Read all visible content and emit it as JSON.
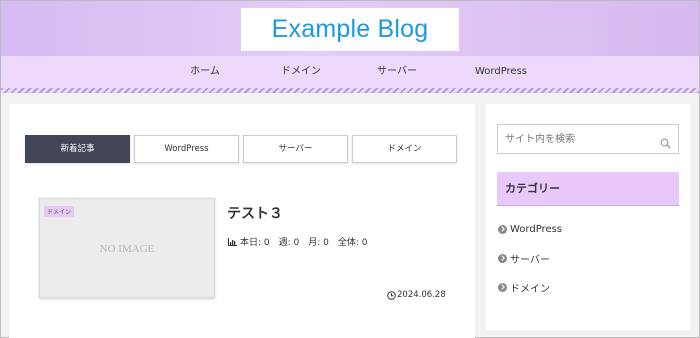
{
  "header": {
    "site_title": "Example Blog"
  },
  "nav": {
    "items": [
      {
        "label": "ホーム"
      },
      {
        "label": "ドメイン"
      },
      {
        "label": "サーバー"
      },
      {
        "label": "WordPress"
      }
    ]
  },
  "tabs": [
    {
      "label": "新着記事",
      "active": true
    },
    {
      "label": "WordPress"
    },
    {
      "label": "サーバー"
    },
    {
      "label": "ドメイン"
    }
  ],
  "post": {
    "category_badge": "ドメイン",
    "thumbnail_text": "NO IMAGE",
    "title": "テスト３",
    "stats": "本日: 0　週: 0　月: 0　全体: 0",
    "date": "2024.06.28"
  },
  "sidebar": {
    "search_placeholder": "サイト内を検索",
    "category_heading": "カテゴリー",
    "categories": [
      {
        "label": "WordPress"
      },
      {
        "label": "サーバー"
      },
      {
        "label": "ドメイン"
      }
    ]
  },
  "colors": {
    "title_blue": "#1a9ae0",
    "header_purple": "#d6baf2",
    "nav_purple": "#ecd9fb",
    "active_tab": "#414555",
    "category_bg": "#e9c9fb"
  }
}
